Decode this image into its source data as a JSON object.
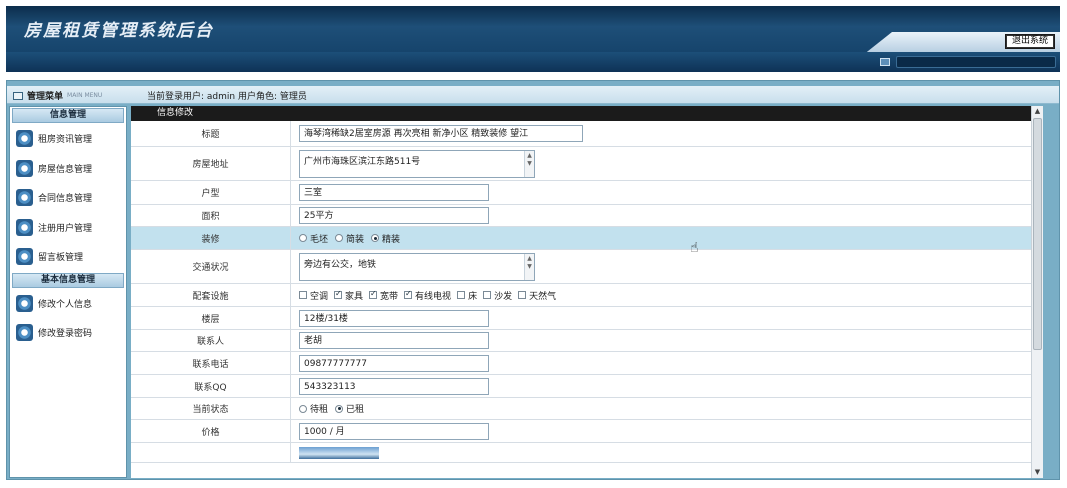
{
  "app": {
    "title": "房屋租赁管理系统后台",
    "logout_label": "退出系统"
  },
  "menu": {
    "title": "管理菜单",
    "subtitle": "MAIN MENU"
  },
  "status": {
    "user_line": "当前登录用户: admin 用户角色: 管理员"
  },
  "sidebar": {
    "section1": "信息管理",
    "items1": [
      "租房资讯管理",
      "房屋信息管理",
      "合同信息管理",
      "注册用户管理",
      "留言板管理"
    ],
    "section2": "基本信息管理",
    "items2": [
      "修改个人信息",
      "修改登录密码"
    ]
  },
  "panel": {
    "header": "信息修改"
  },
  "form": {
    "title_label": "标题",
    "title_value": "海琴湾稀缺2居室房源 再次亮相 新净小区 精致装修 望江",
    "address_label": "房屋地址",
    "address_value": "广州市海珠区滨江东路511号",
    "layout_label": "户型",
    "layout_value": "三室",
    "area_label": "面积",
    "area_value": "25平方",
    "decor_label": "装修",
    "decor_options": [
      "毛坯",
      "简装",
      "精装"
    ],
    "decor_selected": "精装",
    "traffic_label": "交通状况",
    "traffic_value": "旁边有公交，地铁",
    "facilities_label": "配套设施",
    "facilities": [
      {
        "name": "空调",
        "checked": false
      },
      {
        "name": "家具",
        "checked": true
      },
      {
        "name": "宽带",
        "checked": true
      },
      {
        "name": "有线电视",
        "checked": true
      },
      {
        "name": "床",
        "checked": false
      },
      {
        "name": "沙发",
        "checked": false
      },
      {
        "name": "天然气",
        "checked": false
      }
    ],
    "floor_label": "楼层",
    "floor_value": "12楼/31楼",
    "contact_label": "联系人",
    "contact_value": "老胡",
    "phone_label": "联系电话",
    "phone_value": "09877777777",
    "qq_label": "联系QQ",
    "qq_value": "543323113",
    "state_label": "当前状态",
    "state_options": [
      "待租",
      "已租"
    ],
    "state_selected": "已租",
    "price_label": "价格",
    "price_value": "1000 / 月"
  }
}
